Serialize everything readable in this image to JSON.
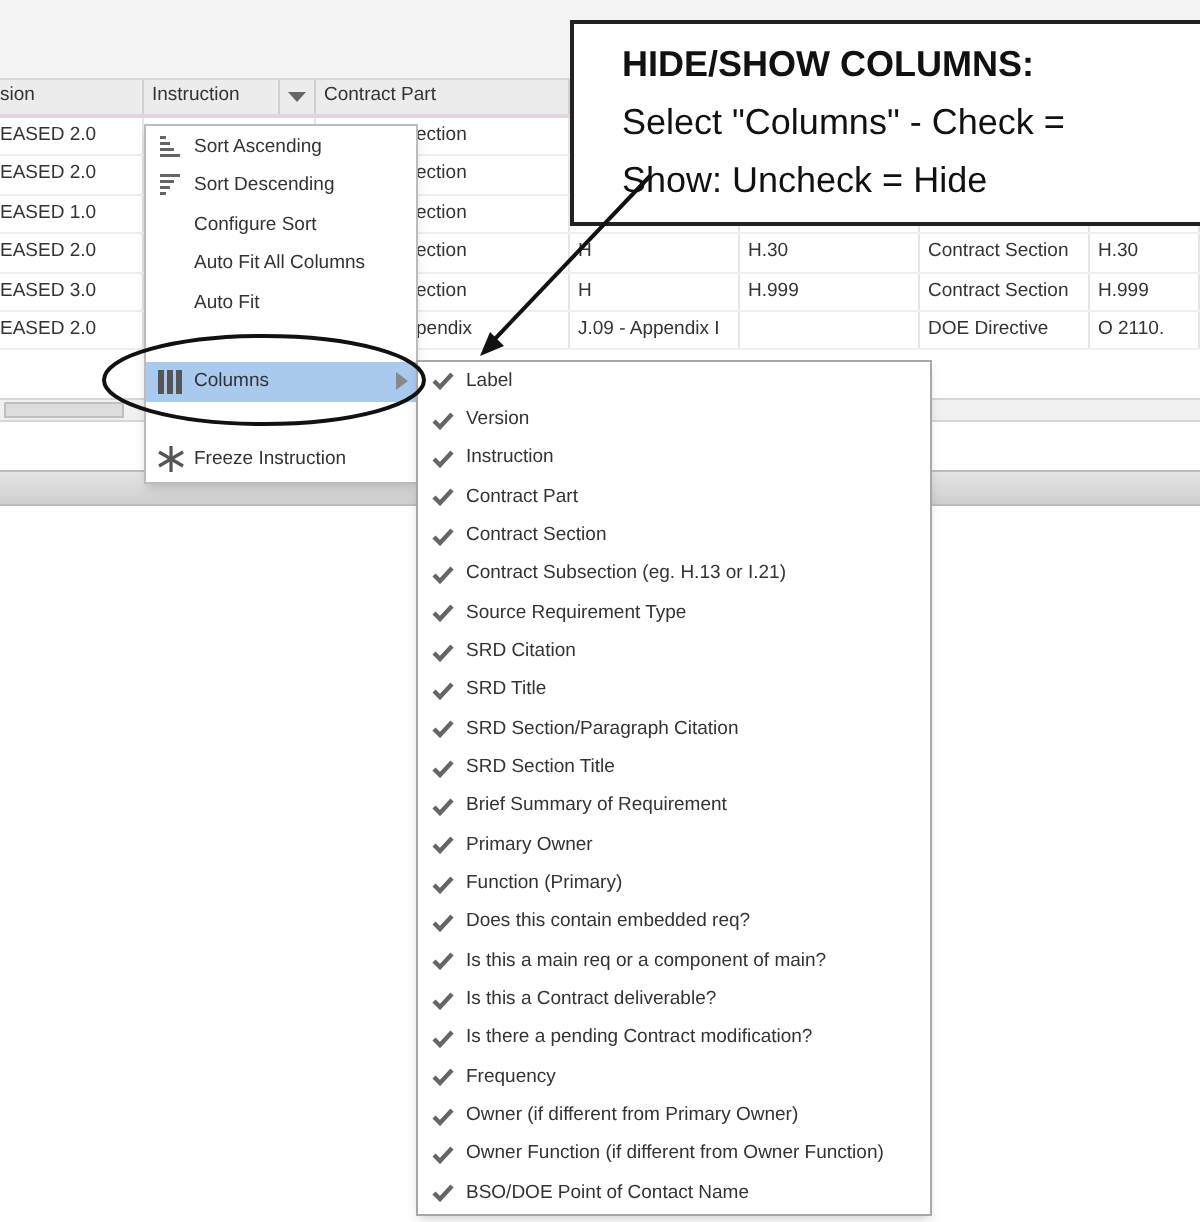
{
  "table": {
    "columns": [
      {
        "label": "sion"
      },
      {
        "label": "Instruction"
      },
      {
        "label": "Contract Part"
      }
    ],
    "rows": [
      {
        "version": "EASED 2.0",
        "contract_part": "ection"
      },
      {
        "version": "EASED 2.0",
        "contract_part": "ection"
      },
      {
        "version": "EASED 1.0",
        "contract_part": "ection"
      },
      {
        "version": "EASED 2.0",
        "contract_part": "ection",
        "column_4": "H",
        "column_5": "H.30",
        "column_6": "Contract Section",
        "column_7": "H.30"
      },
      {
        "version": "EASED 3.0",
        "contract_part": "ection",
        "column_4": "H",
        "column_5": "H.999",
        "column_6": "Contract Section",
        "column_7": "H.999"
      },
      {
        "version": "EASED 2.0",
        "contract_part": "pendix",
        "column_4": "J.09 - Appendix I",
        "column_6": "DOE Directive",
        "column_7": "O 2110."
      }
    ]
  },
  "column_menu": {
    "items": [
      {
        "kind": "sort_ascending",
        "label": "Sort Ascending",
        "selected": false
      },
      {
        "kind": "sort_descending",
        "label": "Sort Descending",
        "selected": false
      },
      {
        "kind": "plain",
        "label": "Configure Sort",
        "selected": false
      },
      {
        "kind": "plain",
        "label": "Auto Fit All Columns",
        "selected": false
      },
      {
        "kind": "plain",
        "label": "Auto Fit",
        "selected": false
      },
      {
        "kind": "blank"
      },
      {
        "kind": "columns",
        "label": "Columns",
        "selected": true
      },
      {
        "kind": "blank"
      },
      {
        "kind": "freeze",
        "label": "Freeze Instruction",
        "selected": false
      }
    ]
  },
  "columns_submenu": [
    {
      "label": "Label",
      "checked": true
    },
    {
      "label": "Version",
      "checked": true
    },
    {
      "label": "Instruction",
      "checked": true
    },
    {
      "label": "Contract Part",
      "checked": true
    },
    {
      "label": "Contract Section",
      "checked": true
    },
    {
      "label": "Contract Subsection (eg. H.13 or I.21)",
      "checked": true
    },
    {
      "label": "Source Requirement Type",
      "checked": true
    },
    {
      "label": "SRD Citation",
      "checked": true
    },
    {
      "label": "SRD Title",
      "checked": true
    },
    {
      "label": "SRD Section/Paragraph Citation",
      "checked": true
    },
    {
      "label": "SRD Section Title",
      "checked": true
    },
    {
      "label": "Brief Summary of Requirement",
      "checked": true
    },
    {
      "label": "Primary Owner",
      "checked": true
    },
    {
      "label": "Function (Primary)",
      "checked": true
    },
    {
      "label": "Does this contain embedded req?",
      "checked": true
    },
    {
      "label": "Is this a main req or a component of main?",
      "checked": true
    },
    {
      "label": "Is this a Contract deliverable?",
      "checked": true
    },
    {
      "label": "Is there a pending Contract modification?",
      "checked": true
    },
    {
      "label": "Frequency",
      "checked": true
    },
    {
      "label": "Owner (if different from Primary Owner)",
      "checked": true
    },
    {
      "label": "Owner Function (if different from Owner Function)",
      "checked": true
    },
    {
      "label": "BSO/DOE Point of Contact Name",
      "checked": true
    }
  ],
  "callout": {
    "title": "HIDE/SHOW COLUMNS:",
    "text": "Select \"Columns\" - Check = Show: Uncheck = Hide"
  }
}
